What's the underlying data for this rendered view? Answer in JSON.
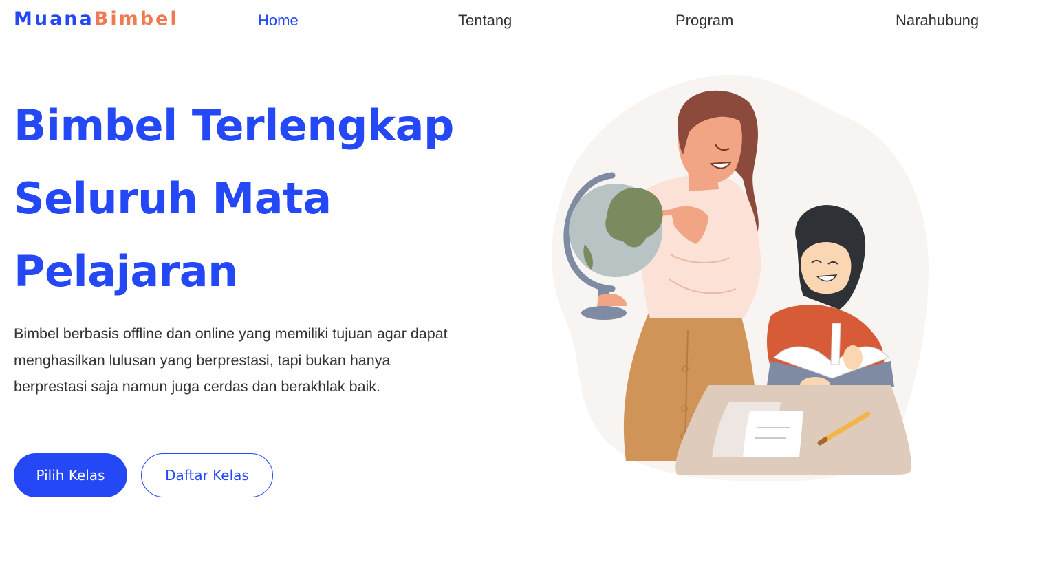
{
  "brand": {
    "part1": "Muana",
    "part2": "Bimbel"
  },
  "nav": {
    "home": "Home",
    "about": "Tentang",
    "program": "Program",
    "contact": "Narahubung"
  },
  "hero": {
    "title_line1": "Bimbel Terlengkap",
    "title_line2": "Seluruh Mata",
    "title_line3": "Pelajaran",
    "description": "Bimbel berbasis offline dan online yang memiliki tujuan agar dapat menghasilkan lulusan yang berprestasi, tapi bukan hanya berprestasi saja namun juga cerdas dan berakhlak baik.",
    "primary_button": "Pilih Kelas",
    "secondary_button": "Daftar Kelas"
  },
  "colors": {
    "accent": "#2448f5",
    "brand_secondary": "#f07a4f",
    "text": "#333333"
  }
}
